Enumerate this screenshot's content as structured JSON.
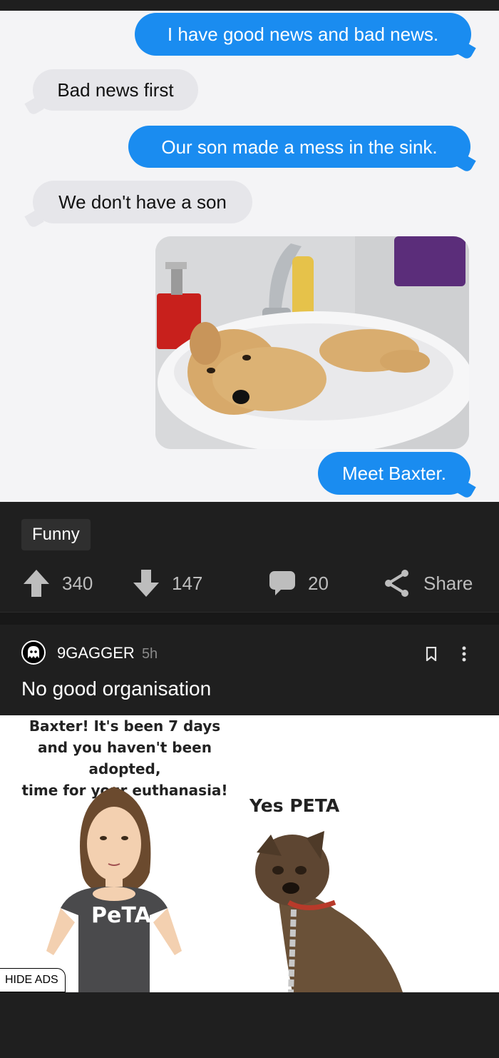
{
  "post1": {
    "messages": [
      {
        "side": "sent",
        "text": "I have good news and bad news."
      },
      {
        "side": "received",
        "text": "Bad news first"
      },
      {
        "side": "sent",
        "text": "Our son made a mess in the sink."
      },
      {
        "side": "received",
        "text": "We don't have a son"
      },
      {
        "side": "sent",
        "text": "Meet Baxter."
      }
    ],
    "tag": "Funny",
    "upvotes": "340",
    "downvotes": "147",
    "comments": "20",
    "share_label": "Share"
  },
  "post2": {
    "author": "9GAGGER",
    "age": "5h",
    "title": "No good organisation",
    "meme_caption_lines": [
      "Baxter! It's been 7 days",
      "and you haven't been adopted,",
      "time for your euthanasia!"
    ],
    "meme_reply": "Yes PETA",
    "shirt_text": "PeTA"
  },
  "hide_ads_label": "HIDE ADS",
  "colors": {
    "sent_bubble": "#1a8cf0",
    "received_bubble": "#e6e6ea",
    "app_background": "#1f1f1f",
    "action_icon": "#bdbdbd"
  }
}
